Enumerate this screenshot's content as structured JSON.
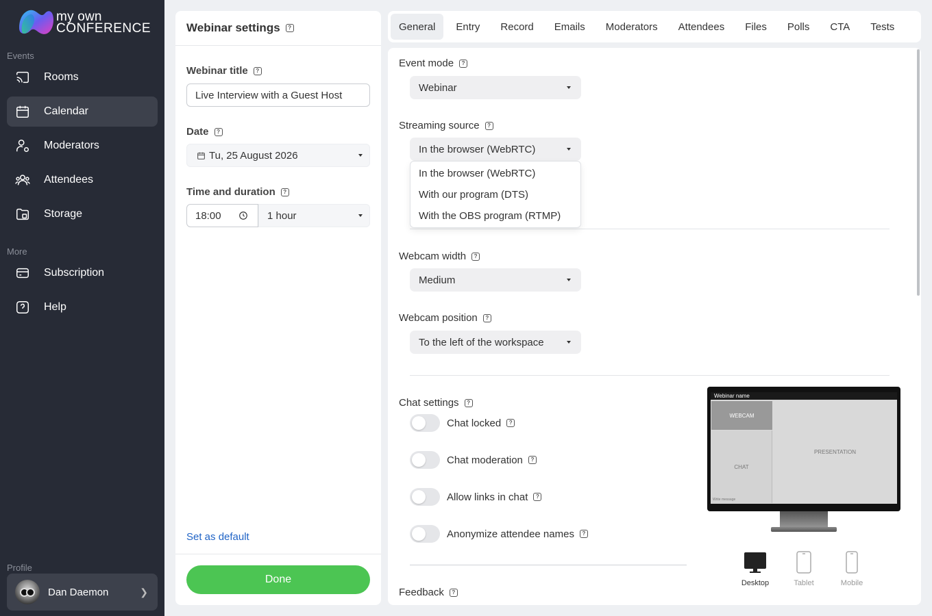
{
  "brand": {
    "line1": "my own",
    "line2": "CONFERENCE"
  },
  "sidebar": {
    "section_events": "Events",
    "section_more": "More",
    "section_profile": "Profile",
    "items": [
      {
        "label": "Rooms",
        "icon": "cast-icon"
      },
      {
        "label": "Calendar",
        "icon": "calendar-icon",
        "active": true
      },
      {
        "label": "Moderators",
        "icon": "user-gear-icon"
      },
      {
        "label": "Attendees",
        "icon": "users-icon"
      },
      {
        "label": "Storage",
        "icon": "folder-icon"
      },
      {
        "label": "Subscription",
        "icon": "wallet-icon"
      },
      {
        "label": "Help",
        "icon": "help-icon"
      }
    ],
    "profile_name": "Dan Daemon"
  },
  "left_panel": {
    "title": "Webinar settings",
    "webinar_title_label": "Webinar title",
    "webinar_title_value": "Live Interview with a Guest Host",
    "date_label": "Date",
    "date_value": "Tu, 25 August 2026",
    "time_label": "Time and duration",
    "time_value": "18:00",
    "duration_value": "1 hour",
    "set_default": "Set as default",
    "done": "Done"
  },
  "tabs": [
    "General",
    "Entry",
    "Record",
    "Emails",
    "Moderators",
    "Attendees",
    "Files",
    "Polls",
    "CTA",
    "Tests"
  ],
  "general": {
    "event_mode_label": "Event mode",
    "event_mode_value": "Webinar",
    "streaming_source_label": "Streaming source",
    "streaming_source_value": "In the browser (WebRTC)",
    "streaming_options": [
      "In the browser (WebRTC)",
      "With our program (DTS)",
      "With the OBS program (RTMP)"
    ],
    "webcam_width_label": "Webcam width",
    "webcam_width_value": "Medium",
    "webcam_position_label": "Webcam position",
    "webcam_position_value": "To the left of the workspace",
    "chat_settings_label": "Chat settings",
    "toggles": [
      {
        "label": "Chat locked",
        "on": false
      },
      {
        "label": "Chat moderation",
        "on": false
      },
      {
        "label": "Allow links in chat",
        "on": false
      },
      {
        "label": "Anonymize attendee names",
        "on": false
      }
    ],
    "feedback_label": "Feedback"
  },
  "preview": {
    "webinar_name": "Webinar name",
    "webcam": "WEBCAM",
    "chat": "CHAT",
    "presentation": "PRESENTATION",
    "write_message": "Write message",
    "devices": [
      "Desktop",
      "Tablet",
      "Mobile"
    ],
    "active_device": "Desktop"
  },
  "colors": {
    "sidebar_bg": "#272b36",
    "done_green": "#4cc553",
    "link_blue": "#1f63c6"
  }
}
